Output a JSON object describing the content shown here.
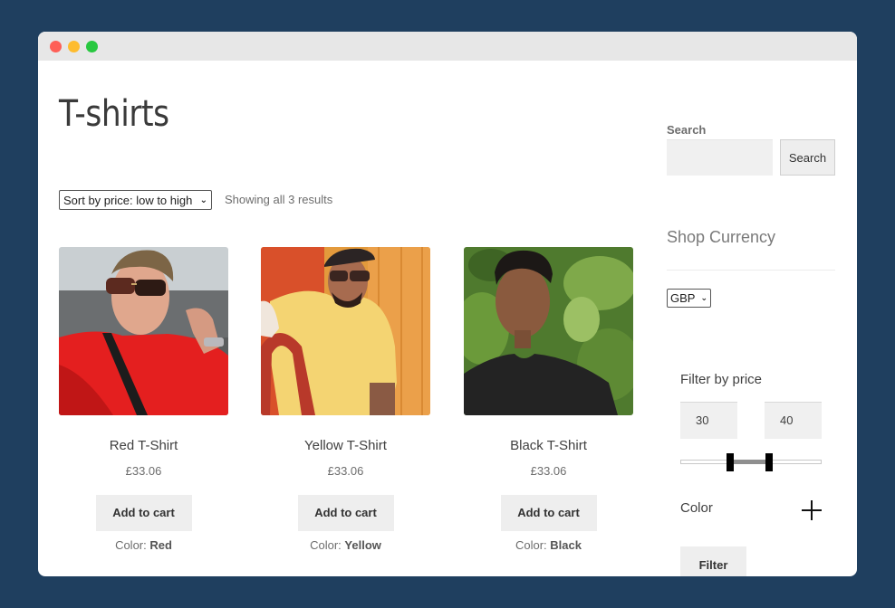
{
  "window": {
    "controls": [
      "close",
      "minimize",
      "maximize"
    ]
  },
  "page": {
    "title": "T-shirts",
    "sort": {
      "selected": "Sort by price: low to high"
    },
    "results_count": "Showing all 3 results"
  },
  "products": [
    {
      "name": "Red T-Shirt",
      "price": "£33.06",
      "cart_label": "Add to cart",
      "color_label": "Color:",
      "color_value": "Red",
      "image": "man-in-red-tshirt-sunglasses"
    },
    {
      "name": "Yellow T-Shirt",
      "price": "£33.06",
      "cart_label": "Add to cart",
      "color_label": "Color:",
      "color_value": "Yellow",
      "image": "man-in-yellow-tshirt-cap-sunglasses"
    },
    {
      "name": "Black T-Shirt",
      "price": "£33.06",
      "cart_label": "Add to cart",
      "color_label": "Color:",
      "color_value": "Black",
      "image": "man-in-black-tshirt-foliage"
    }
  ],
  "sidebar": {
    "search": {
      "label": "Search",
      "value": "",
      "placeholder": "",
      "button_label": "Search"
    },
    "currency": {
      "title": "Shop Currency",
      "selected": "GBP"
    },
    "price_filter": {
      "title": "Filter by price",
      "min_value": "30",
      "max_value": "40",
      "range_start_fraction": 0.35,
      "range_end_fraction": 0.63
    },
    "color_filter": {
      "label": "Color",
      "expand_icon": "plus-icon"
    },
    "filter_button_label": "Filter"
  },
  "colors": {
    "background": "#1f3f5f",
    "titlebar": "#e7e7e7",
    "button_bg": "#eeeeee",
    "close": "#fe5f57",
    "minimize": "#febc2e",
    "maximize": "#28c840"
  }
}
